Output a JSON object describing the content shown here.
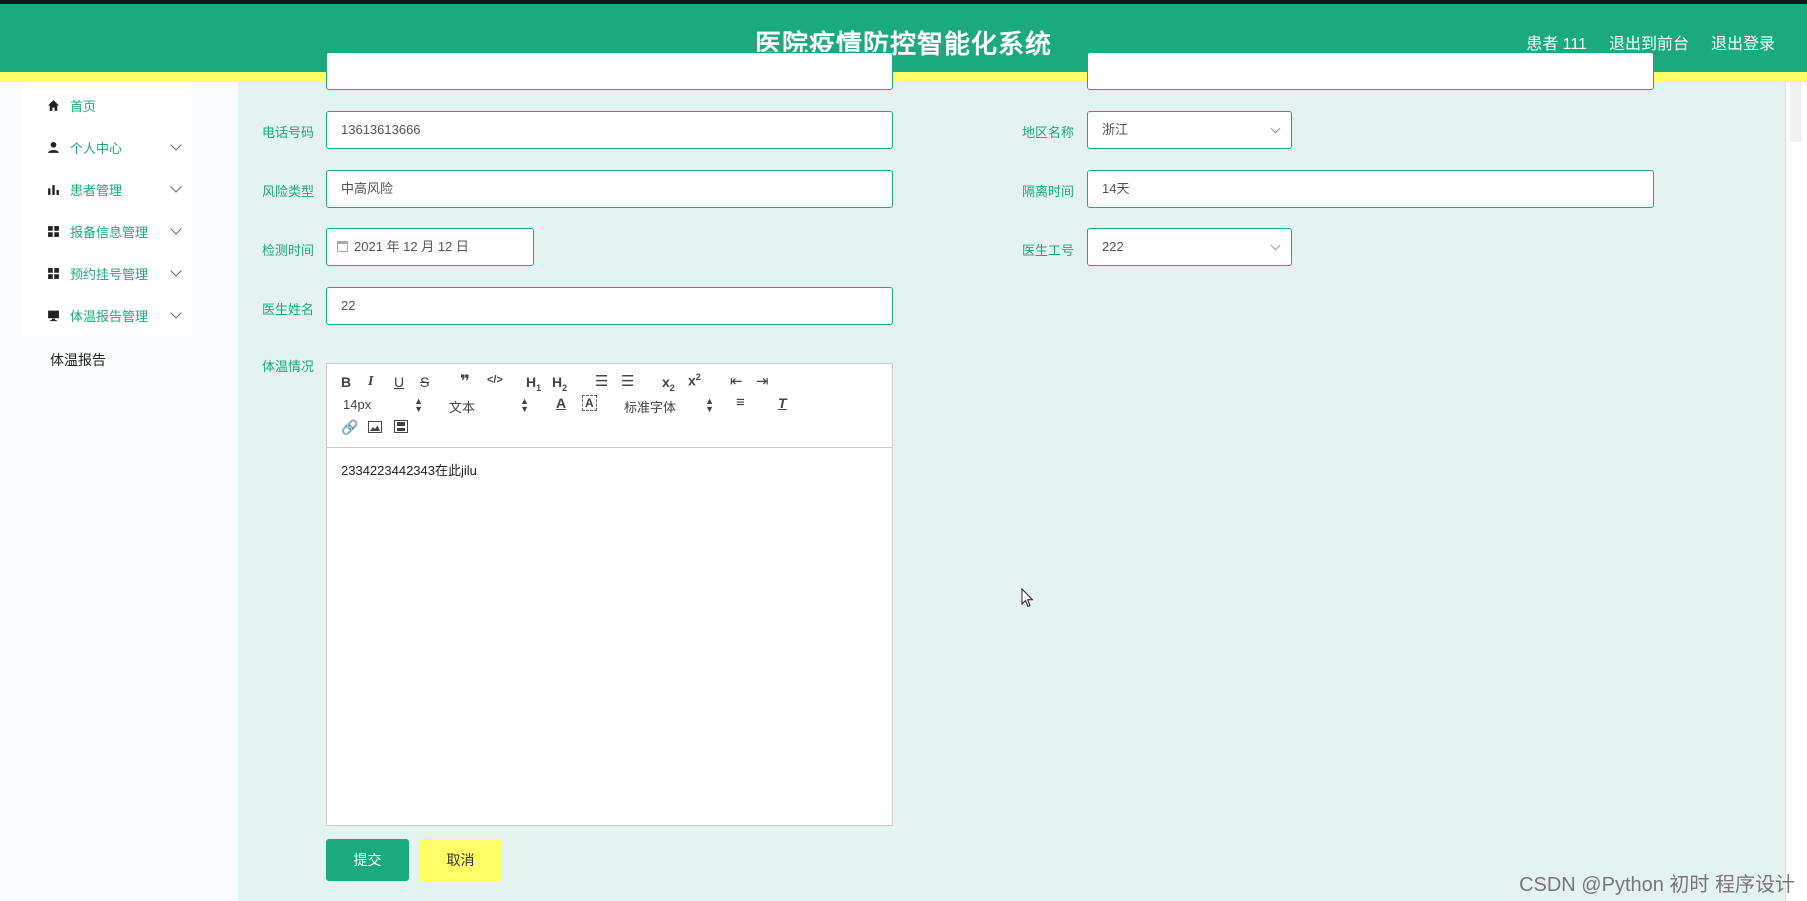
{
  "header": {
    "title": "医院疫情防控智能化系统",
    "user": "患者 111",
    "to_front": "退出到前台",
    "logout": "退出登录"
  },
  "sidebar": {
    "items": [
      {
        "label": "首页",
        "icon": "home-icon"
      },
      {
        "label": "个人中心",
        "icon": "user-icon"
      },
      {
        "label": "患者管理",
        "icon": "bar-chart-icon"
      },
      {
        "label": "报备信息管理",
        "icon": "grid-icon"
      },
      {
        "label": "预约挂号管理",
        "icon": "grid-icon"
      },
      {
        "label": "体温报告管理",
        "icon": "monitor-icon"
      }
    ],
    "subitem": "体温报告"
  },
  "form": {
    "phone_label": "电话号码",
    "phone_value": "13613613666",
    "region_label": "地区名称",
    "region_value": "浙江",
    "risk_label": "风险类型",
    "risk_value": "中高风险",
    "isolation_label": "隔离时间",
    "isolation_value": "14天",
    "test_time_label": "检测时间",
    "test_time_value": "2021 年 12 月 12 日",
    "doctor_id_label": "医生工号",
    "doctor_id_value": "222",
    "doctor_name_label": "医生姓名",
    "doctor_name_value": "22",
    "temp_label": "体温情况"
  },
  "editor": {
    "font_size": "14px",
    "text_style": "文本",
    "font_family": "标准字体",
    "content": "2334223442343在此jilu"
  },
  "buttons": {
    "submit": "提交",
    "cancel": "取消"
  },
  "watermark": "CSDN @Python 初时 程序设计",
  "colors": {
    "primary": "#1aaa7d",
    "accent": "#ffff66",
    "background": "#e4f3ef"
  }
}
